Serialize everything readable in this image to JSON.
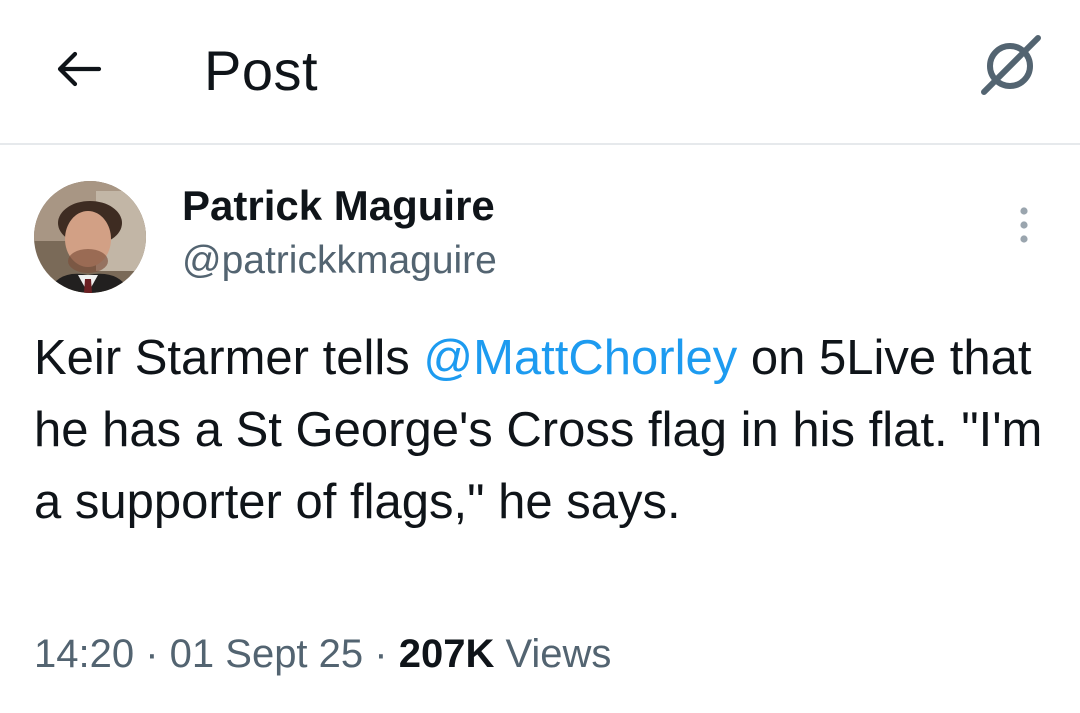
{
  "header": {
    "title": "Post",
    "back_icon": "arrow-left-icon",
    "grok_icon": "grok-icon"
  },
  "author": {
    "display_name": "Patrick Maguire",
    "handle": "@patrickkmaguire",
    "avatar": "profile-photo"
  },
  "tweet": {
    "text_part1": "Keir Starmer tells ",
    "mention": "@MattChorley",
    "text_part2": " on 5Live that he has a St George's Cross flag in his flat. \"I'm a supporter of flags,\" he says."
  },
  "meta": {
    "time": "14:20",
    "separator": " · ",
    "date": "01 Sept 25",
    "views_count": "207K",
    "views_label": " Views"
  },
  "colors": {
    "link": "#1d9bf0",
    "secondary_text": "#536471",
    "primary_text": "#0f1419",
    "divider": "#e6e9ec"
  }
}
